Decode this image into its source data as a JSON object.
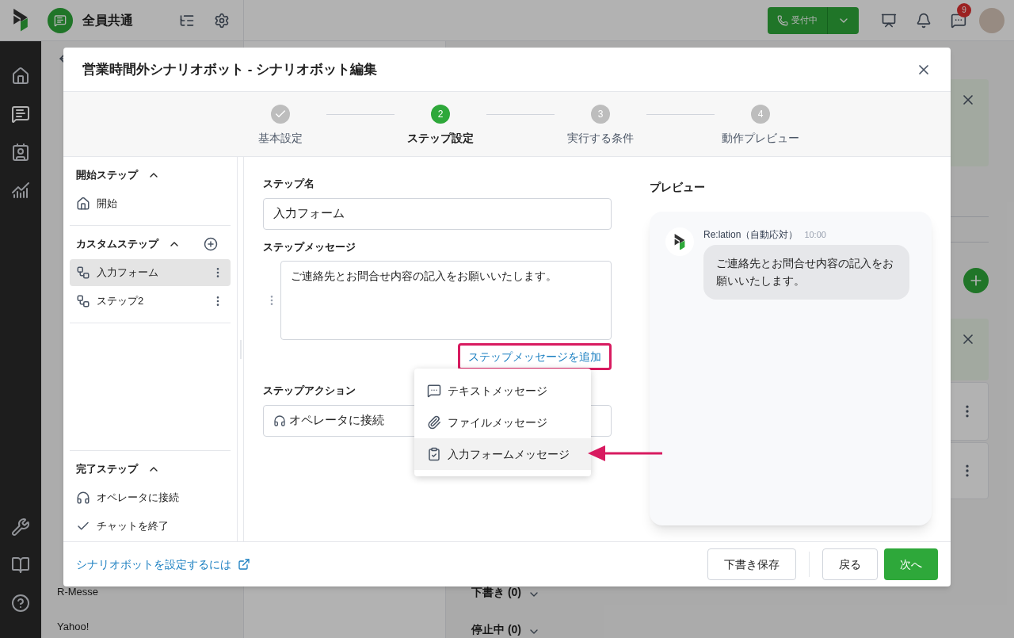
{
  "top_bar": {
    "workspace": "全員共通",
    "call_status_button": "受付中",
    "notification_badge": "9"
  },
  "background_sidebar": [
    "R-Messe",
    "Yahoo!"
  ],
  "background_sections": [
    "下書き (0)",
    "停止中 (0)"
  ],
  "dialog": {
    "title": "営業時間外シナリオボット - シナリオボット編集",
    "steps": [
      {
        "label": "基本設定",
        "done": true,
        "selected": false
      },
      {
        "number": "2",
        "label": "ステップ設定",
        "done": false,
        "selected": true
      },
      {
        "number": "3",
        "label": "実行する条件",
        "done": false,
        "selected": false
      },
      {
        "number": "4",
        "label": "動作プレビュー",
        "done": false,
        "selected": false
      }
    ],
    "step_groups": [
      {
        "title": "開始ステップ",
        "expanded": true,
        "addable": false,
        "items": [
          {
            "label": "開始",
            "kind": "start",
            "selected": false
          }
        ]
      },
      {
        "title": "カスタムステップ",
        "expanded": true,
        "addable": true,
        "items": [
          {
            "label": "入力フォーム",
            "kind": "custom",
            "selected": true
          },
          {
            "label": "ステップ2",
            "kind": "custom",
            "selected": false
          }
        ]
      },
      {
        "title": "完了ステップ",
        "expanded": true,
        "addable": false,
        "items": [
          {
            "label": "オペレータに接続",
            "kind": "operator",
            "selected": false
          },
          {
            "label": "チャットを終了",
            "kind": "end",
            "selected": false
          }
        ]
      }
    ],
    "help_link": "シナリオボットを設定するには",
    "form": {
      "step_name_label": "ステップ名",
      "step_name_value": "入力フォーム",
      "message_label": "ステップメッセージ",
      "message_value": "ご連絡先とお問合せ内容の記入をお願いいたします。",
      "add_message_link": "ステップメッセージを追加",
      "action_label": "ステップアクション",
      "action_value": "オペレータに接続"
    },
    "message_type_menu": [
      {
        "kind": "text",
        "label": "テキストメッセージ",
        "selected": false
      },
      {
        "kind": "file",
        "label": "ファイルメッセージ",
        "selected": false
      },
      {
        "kind": "form",
        "label": "入力フォームメッセージ",
        "selected": true
      }
    ],
    "preview": {
      "title": "プレビュー",
      "sender": "Re:lation（自動応対）",
      "time": "10:00",
      "message": "ご連絡先とお問合せ内容の記入をお願いいたします。"
    },
    "footer_buttons": [
      {
        "label": "下書き保存",
        "kind": "secondary"
      },
      {
        "label": "戻る",
        "kind": "secondary"
      },
      {
        "label": "次へ",
        "kind": "primary"
      }
    ]
  }
}
